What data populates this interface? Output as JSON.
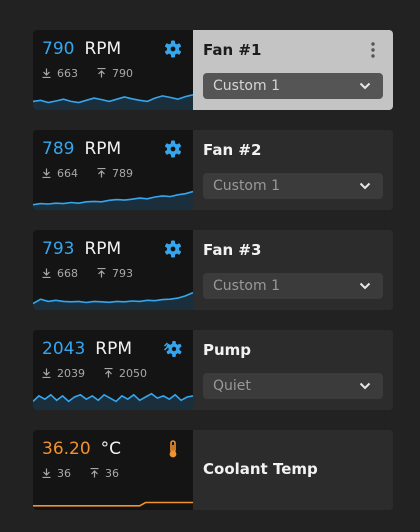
{
  "colors": {
    "accent_blue": "#35a6ee",
    "accent_orange": "#f0922e",
    "active_panel": "#c4c4c4"
  },
  "sensors": [
    {
      "value": "790",
      "unit": "RPM",
      "min": "663",
      "max": "790",
      "name": "Fan #1",
      "profile": "Custom 1",
      "icon": "gear-icon",
      "sparkline": [
        0.3,
        0.35,
        0.25,
        0.32,
        0.4,
        0.3,
        0.25,
        0.35,
        0.45,
        0.38,
        0.3,
        0.4,
        0.5,
        0.42,
        0.35,
        0.3,
        0.45,
        0.55,
        0.48,
        0.4,
        0.52,
        0.6
      ]
    },
    {
      "value": "789",
      "unit": "RPM",
      "min": "664",
      "max": "789",
      "name": "Fan #2",
      "profile": "Custom 1",
      "icon": "gear-icon",
      "sparkline": [
        0.15,
        0.2,
        0.18,
        0.22,
        0.2,
        0.25,
        0.22,
        0.28,
        0.3,
        0.28,
        0.35,
        0.38,
        0.36,
        0.4,
        0.45,
        0.42,
        0.5,
        0.55,
        0.52,
        0.6,
        0.65,
        0.75
      ]
    },
    {
      "value": "793",
      "unit": "RPM",
      "min": "668",
      "max": "793",
      "name": "Fan #3",
      "profile": "Custom 1",
      "icon": "gear-icon",
      "sparkline": [
        0.2,
        0.4,
        0.3,
        0.35,
        0.3,
        0.28,
        0.3,
        0.25,
        0.3,
        0.28,
        0.26,
        0.3,
        0.28,
        0.32,
        0.3,
        0.35,
        0.33,
        0.38,
        0.4,
        0.45,
        0.55,
        0.7
      ]
    },
    {
      "value": "2043",
      "unit": "RPM",
      "min": "2039",
      "max": "2050",
      "name": "Pump",
      "profile": "Quiet",
      "icon": "pump-gear-icon",
      "sparkline": [
        0.3,
        0.55,
        0.4,
        0.6,
        0.35,
        0.55,
        0.3,
        0.5,
        0.6,
        0.4,
        0.55,
        0.35,
        0.6,
        0.45,
        0.3,
        0.55,
        0.4,
        0.6,
        0.35,
        0.5,
        0.65,
        0.45,
        0.55,
        0.4,
        0.6,
        0.35,
        0.5,
        0.55
      ]
    },
    {
      "value": "36.20",
      "unit": "°C",
      "min": "36",
      "max": "36",
      "name": "Coolant Temp",
      "icon": "thermometer-icon",
      "sparkline": [
        0.1,
        0.1,
        0.1,
        0.1,
        0.1,
        0.1,
        0.1,
        0.1,
        0.1,
        0.1,
        0.1,
        0.1,
        0.1,
        0.1,
        0.1,
        0.1,
        0.1,
        0.1,
        0.1,
        0.25,
        0.25,
        0.25,
        0.25,
        0.25,
        0.25,
        0.25,
        0.25,
        0.25
      ]
    }
  ]
}
